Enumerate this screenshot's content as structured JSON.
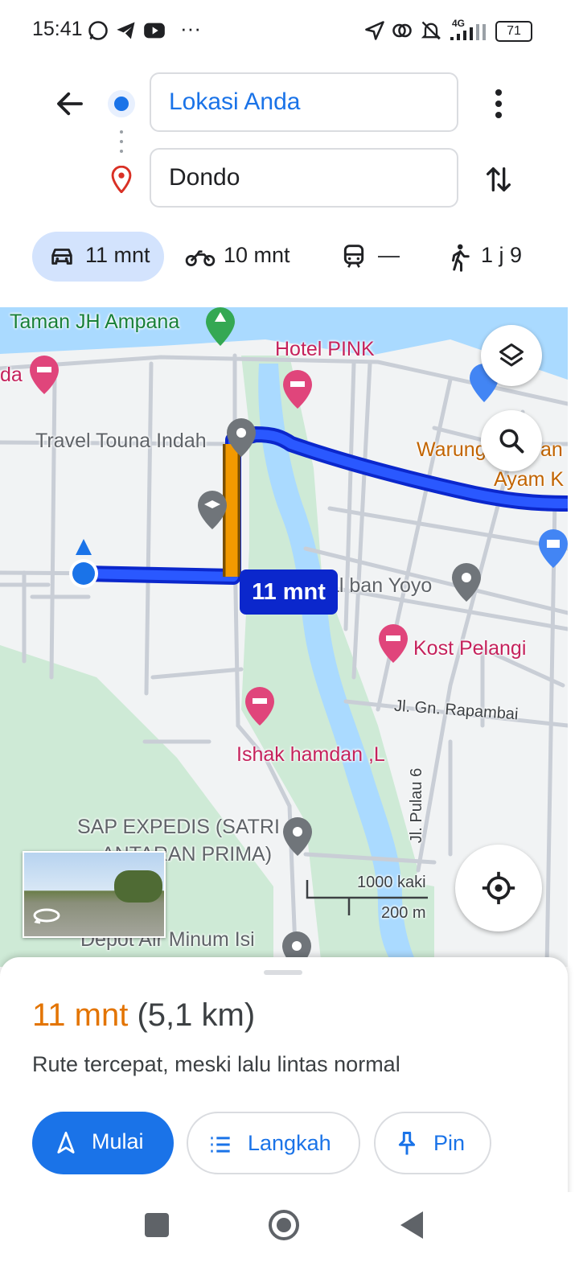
{
  "status_bar": {
    "time": "15:41",
    "overflow": "···",
    "network": "4G",
    "battery": "71"
  },
  "directions": {
    "origin_value": "Lokasi Anda",
    "destination_value": "Dondo"
  },
  "modes": [
    {
      "name": "car",
      "label": "11 mnt",
      "selected": true
    },
    {
      "name": "motorcycle",
      "label": "10 mnt"
    },
    {
      "name": "transit",
      "label": "—"
    },
    {
      "name": "walk",
      "label": "1 j 9"
    }
  ],
  "map": {
    "places": {
      "taman": "Taman JH Ampana",
      "hotel_left": "da",
      "hotel_pink": "Hotel PINK",
      "travel": "Travel Touna Indah",
      "warung1": "Warung",
      "warung2": "an",
      "ayam": "Ayam K",
      "yoyo": "al ban Yoyo",
      "kost": "Kost Pelangi",
      "road_rapambai": "Jl. Gn. Rapambai",
      "ishak": "Ishak hamdan ,L",
      "road_pulau": "Jl. Pulau 6",
      "sap1": "SAP EXPEDIS (SATRI",
      "sap2": "ANTARAN PRIMA)",
      "depot": "Depot Air Minum Isi"
    },
    "eta_badge": "11 mnt",
    "scale_imperial": "1000 kaki",
    "scale_metric": "200 m",
    "route_color": "#0b27cc",
    "traffic_color": "#f29900"
  },
  "summary": {
    "time": "11 mnt",
    "distance": "(5,1 km)",
    "description": "Rute tercepat, meski lalu lintas normal"
  },
  "buttons": {
    "start": "Mulai",
    "steps": "Langkah",
    "pin": "Pin"
  },
  "colors": {
    "accent": "#1a73e8",
    "time_orange": "#e37400"
  }
}
